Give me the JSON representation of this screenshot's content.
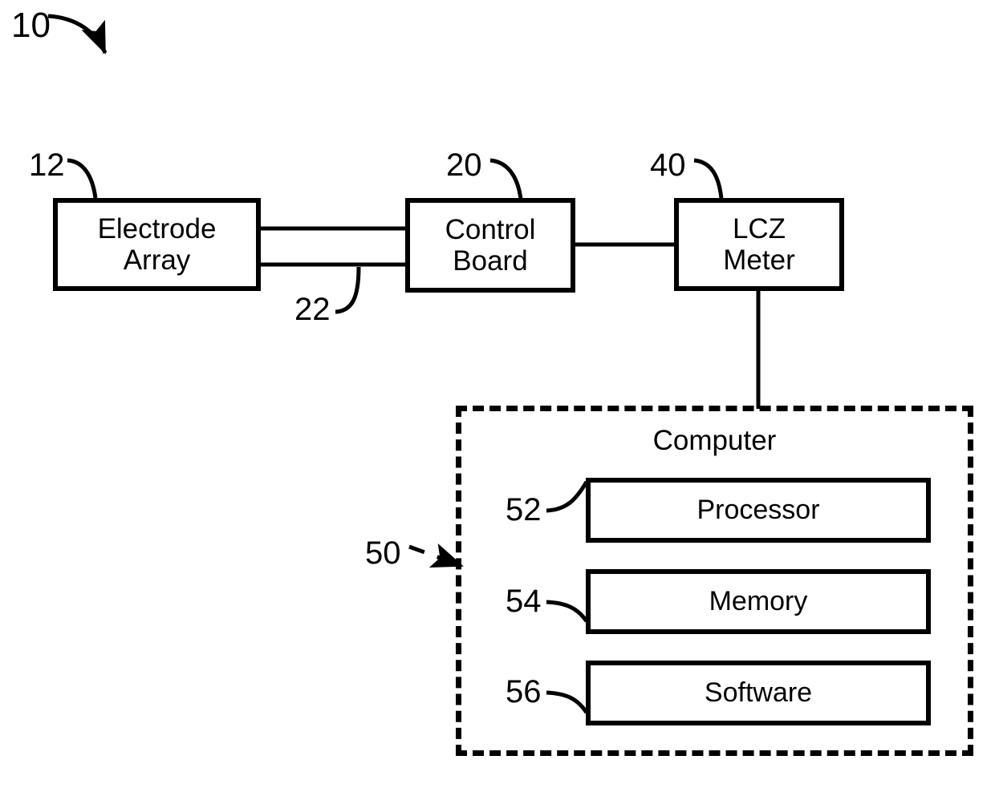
{
  "figure": {
    "title_numeral": "10",
    "background_color": "#ffffff",
    "line_color": "#000000"
  },
  "blocks": [
    {
      "id": "electrode-array",
      "label": "Electrode\nArray",
      "numeral": "12"
    },
    {
      "id": "control-board",
      "label": "Control\nBoard",
      "numeral": "20"
    },
    {
      "id": "lcz-meter",
      "label": "LCZ\nMeter",
      "numeral": "40"
    }
  ],
  "connections": [
    {
      "id": "electrode-to-control",
      "numeral": "22",
      "style": "double-line"
    },
    {
      "id": "control-to-lcz",
      "numeral": "",
      "style": "single-line"
    },
    {
      "id": "lcz-to-computer",
      "numeral": "",
      "style": "single-line"
    }
  ],
  "computer": {
    "title": "Computer",
    "numeral": "50",
    "components": [
      {
        "id": "processor",
        "label": "Processor",
        "numeral": "52"
      },
      {
        "id": "memory",
        "label": "Memory",
        "numeral": "54"
      },
      {
        "id": "software",
        "label": "Software",
        "numeral": "56"
      }
    ]
  }
}
